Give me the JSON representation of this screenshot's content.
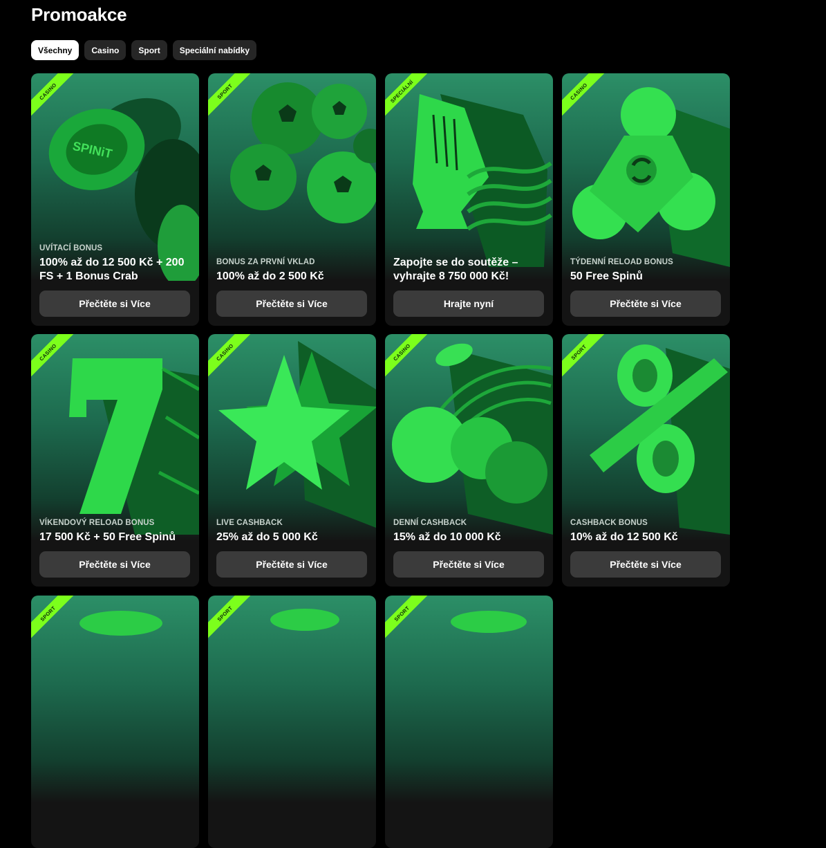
{
  "page": {
    "title": "Promoakce"
  },
  "filters": [
    "Všechny",
    "Casino",
    "Sport",
    "Speciální nabídky"
  ],
  "cards": [
    {
      "tag": "Casino",
      "category": "UVÍTACÍ BONUS",
      "title": "100% až do 12 500 Kč + 200 FS + 1 Bonus Crab",
      "button": "Přečtěte si Více",
      "art": "chips"
    },
    {
      "tag": "Sport",
      "category": "BONUS ZA PRVNÍ VKLAD",
      "title": "100% až do 2 500 Kč",
      "button": "Přečtěte si Více",
      "art": "balls"
    },
    {
      "tag": "Speciální",
      "category": "",
      "title": "Zapojte se do soutěže – vyhrajte 8 750 000 Kč!",
      "button": "Hrajte nyní",
      "art": "trophy"
    },
    {
      "tag": "Casino",
      "category": "TÝDENNÍ RELOAD BONUS",
      "title": "50 Free Spinů",
      "button": "Přečtěte si Více",
      "art": "spinner"
    },
    {
      "tag": "Casino",
      "category": "VÍKENDOVÝ RELOAD BONUS",
      "title": "17 500 Kč + 50 Free Spinů",
      "button": "Přečtěte si Více",
      "art": "seven"
    },
    {
      "tag": "Casino",
      "category": "LIVE CASHBACK",
      "title": "25% až do 5 000 Kč",
      "button": "Přečtěte si Více",
      "art": "star"
    },
    {
      "tag": "Casino",
      "category": "DENNÍ CASHBACK",
      "title": "15% až do 10 000 Kč",
      "button": "Přečtěte si Více",
      "art": "cherry"
    },
    {
      "tag": "Sport",
      "category": "CASHBACK BONUS",
      "title": "10% až do 12 500 Kč",
      "button": "Přečtěte si Více",
      "art": "percent"
    },
    {
      "tag": "Sport",
      "category": "",
      "title": "",
      "button": "",
      "art": "partial"
    },
    {
      "tag": "Sport",
      "category": "",
      "title": "",
      "button": "",
      "art": "partial"
    },
    {
      "tag": "Sport",
      "category": "",
      "title": "",
      "button": "",
      "art": "partial"
    }
  ],
  "colors": {
    "accent": "#7cff1c",
    "card_bg": "#141414",
    "button_bg": "#3b3b3b"
  }
}
